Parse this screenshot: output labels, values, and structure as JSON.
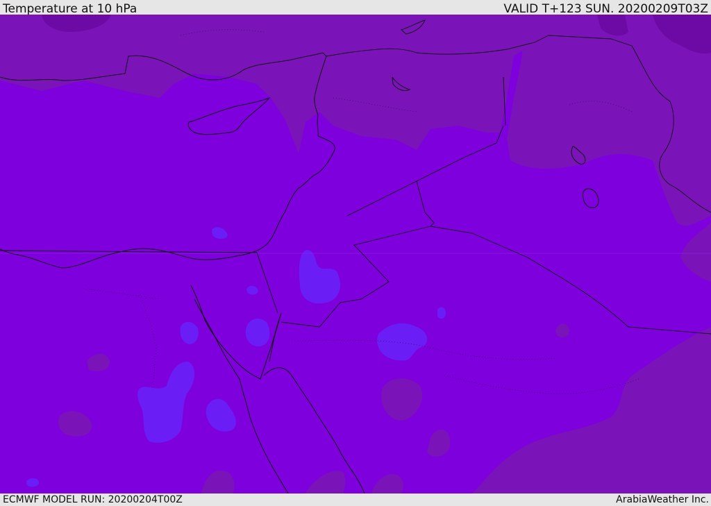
{
  "header": {
    "title": "Temperature at 10 hPa",
    "valid": "VALID T+123 SUN. 20200209T03Z"
  },
  "footer": {
    "model_run": "ECMWF MODEL RUN: 20200204T00Z",
    "credit": "ArabiaWeather Inc."
  },
  "map": {
    "colors": {
      "base": "#7e00dc",
      "warm_band": "#7a14b8",
      "warmer_band": "#6d0aa6",
      "cool_patch": "#6a1ef5",
      "coast": "#111111"
    }
  }
}
